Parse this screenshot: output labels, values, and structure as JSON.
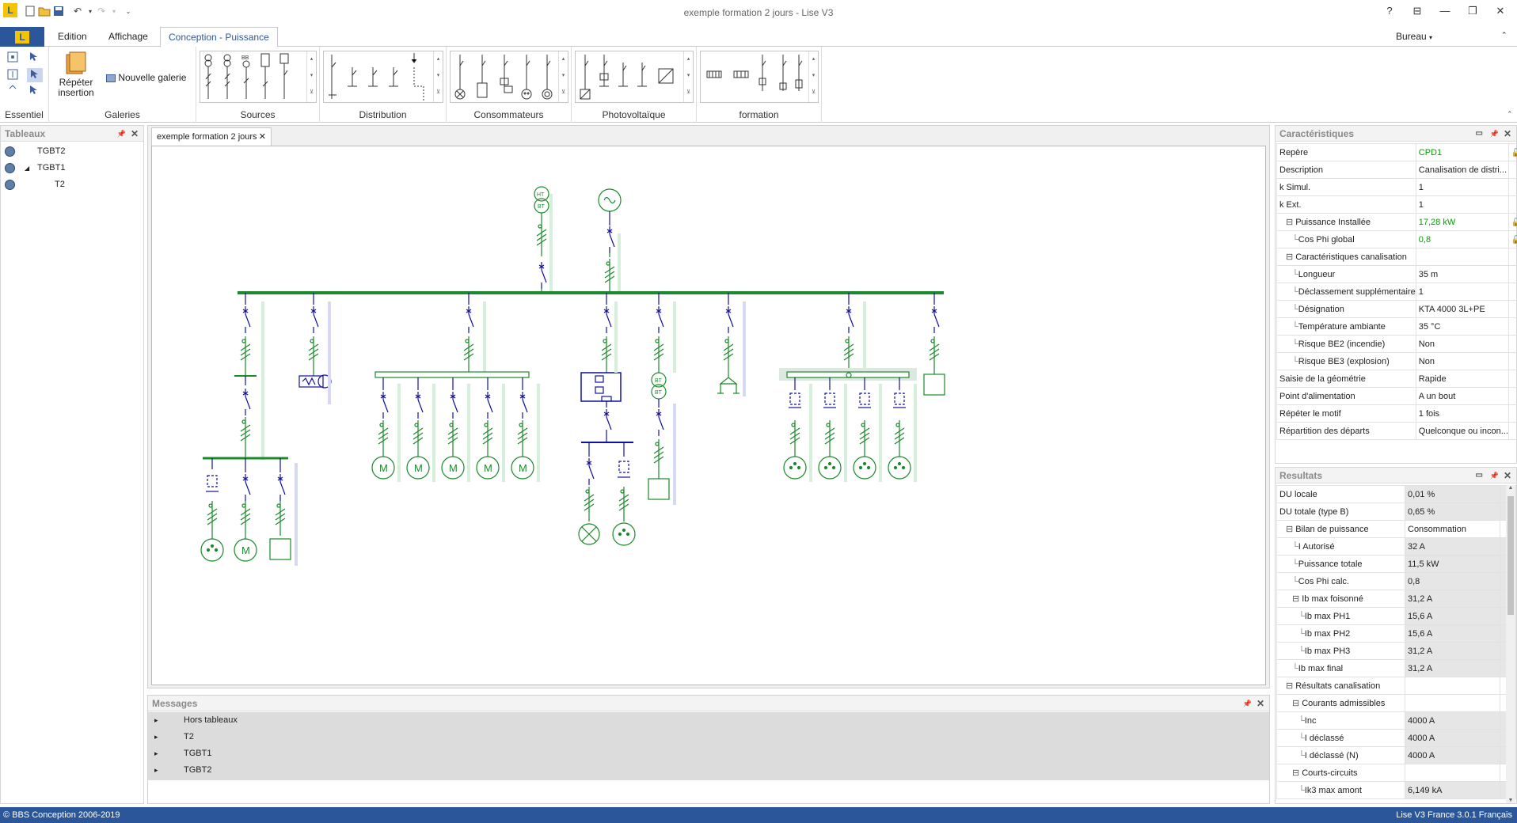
{
  "window": {
    "title": "exemple formation 2 jours - Lise V3",
    "help": "?",
    "workspace": "Bureau"
  },
  "tabs": {
    "file_logo": "L",
    "items": [
      "Edition",
      "Affichage",
      "Conception - Puissance"
    ],
    "active": "Conception - Puissance"
  },
  "ribbon": {
    "repeat_label_1": "Répéter",
    "repeat_label_2": "insertion",
    "new_gallery": "Nouvelle galerie",
    "groups": [
      "Essentiel",
      "Galeries",
      "Sources",
      "Distribution",
      "Consommateurs",
      "Photovoltaïque",
      "formation"
    ]
  },
  "tableaux": {
    "title": "Tableaux",
    "items": [
      "TGBT2",
      "TGBT1",
      "T2"
    ]
  },
  "document": {
    "tab": "exemple formation 2 jours",
    "symbols": {
      "ht": "HT",
      "bt": "BT",
      "motor": "M"
    }
  },
  "caracteristiques": {
    "title": "Caractéristiques",
    "rows": [
      {
        "k": "Repère",
        "v": "CPD1",
        "green": true,
        "lock": true,
        "indent": 0
      },
      {
        "k": "Description",
        "v": "Canalisation de distri...",
        "indent": 0
      },
      {
        "k": "k Simul.",
        "v": "1",
        "indent": 0
      },
      {
        "k": "k Ext.",
        "v": "1",
        "indent": 0
      },
      {
        "k": "Puissance Installée",
        "v": "17,28 kW",
        "green": true,
        "lock": true,
        "indent": 1,
        "collapse": true
      },
      {
        "k": "Cos Phi global",
        "v": "0,8",
        "green": true,
        "lock": true,
        "indent": 2
      },
      {
        "k": "Caractéristiques canalisation",
        "v": "",
        "indent": 1,
        "collapse": true
      },
      {
        "k": "Longueur",
        "v": "35 m",
        "indent": 2
      },
      {
        "k": "Déclassement supplémentaire",
        "v": "1",
        "indent": 2
      },
      {
        "k": "Désignation",
        "v": "KTA 4000 3L+PE",
        "indent": 2
      },
      {
        "k": "Température ambiante",
        "v": "35 °C",
        "indent": 2
      },
      {
        "k": "Risque BE2 (incendie)",
        "v": "Non",
        "indent": 2
      },
      {
        "k": "Risque BE3 (explosion)",
        "v": "Non",
        "indent": 2
      },
      {
        "k": "Saisie de la géométrie",
        "v": "Rapide",
        "indent": 0
      },
      {
        "k": "Point d'alimentation",
        "v": "A un bout",
        "indent": 0
      },
      {
        "k": "Répéter le motif",
        "v": "1 fois",
        "indent": 0
      },
      {
        "k": "Répartition des départs",
        "v": "Quelconque ou incon...",
        "indent": 0
      }
    ]
  },
  "resultats": {
    "title": "Resultats",
    "rows": [
      {
        "k": "DU locale",
        "v": "0,01 %",
        "gray": true,
        "indent": 0
      },
      {
        "k": "DU totale (type B)",
        "v": "0,65 %",
        "gray": true,
        "indent": 0
      },
      {
        "k": "Bilan de puissance",
        "v": "Consommation",
        "indent": 1,
        "collapse": true
      },
      {
        "k": "I Autorisé",
        "v": "32 A",
        "gray": true,
        "indent": 2
      },
      {
        "k": "Puissance totale",
        "v": "11,5 kW",
        "gray": true,
        "indent": 2
      },
      {
        "k": "Cos Phi calc.",
        "v": "0,8",
        "gray": true,
        "indent": 2
      },
      {
        "k": "Ib max foisonné",
        "v": "31,2 A",
        "gray": true,
        "indent": 2,
        "collapse": true
      },
      {
        "k": "Ib max PH1",
        "v": "15,6 A",
        "gray": true,
        "indent": 3
      },
      {
        "k": "Ib max PH2",
        "v": "15,6 A",
        "gray": true,
        "indent": 3
      },
      {
        "k": "Ib max PH3",
        "v": "31,2 A",
        "gray": true,
        "indent": 3
      },
      {
        "k": "Ib max final",
        "v": "31,2 A",
        "gray": true,
        "indent": 2
      },
      {
        "k": "Résultats canalisation",
        "v": "",
        "indent": 1,
        "collapse": true
      },
      {
        "k": "Courants admissibles",
        "v": "",
        "indent": 2,
        "collapse": true
      },
      {
        "k": "Inc",
        "v": "4000 A",
        "gray": true,
        "indent": 3
      },
      {
        "k": "I déclassé",
        "v": "4000 A",
        "gray": true,
        "indent": 3
      },
      {
        "k": "I déclassé (N)",
        "v": "4000 A",
        "gray": true,
        "indent": 3
      },
      {
        "k": "Courts-circuits",
        "v": "",
        "indent": 2,
        "collapse": true
      },
      {
        "k": "Ik3 max amont",
        "v": "6,149 kA",
        "gray": true,
        "indent": 3
      }
    ]
  },
  "messages": {
    "title": "Messages",
    "items": [
      "Hors tableaux",
      "T2",
      "TGBT1",
      "TGBT2"
    ]
  },
  "status": {
    "left": "© BBS Conception 2006-2019",
    "right": "Lise V3 France 3.0.1 Français"
  },
  "colors": {
    "accent": "#2b579a",
    "wire": "#1a8a2a",
    "breaker": "#1010a0",
    "busbar": "#1a8a2a"
  }
}
